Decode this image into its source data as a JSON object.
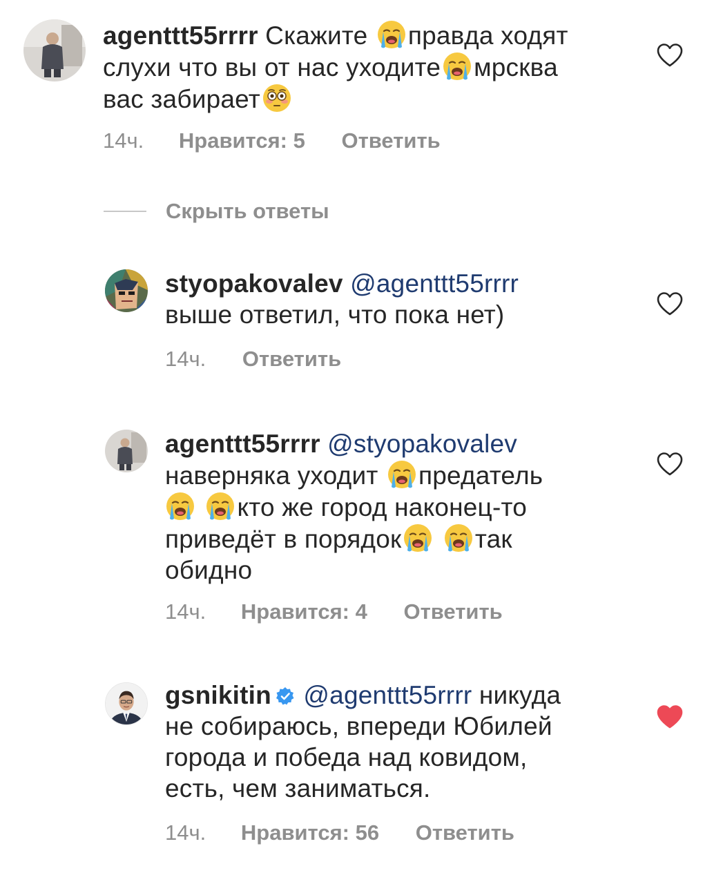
{
  "comments": [
    {
      "username": "agenttt55rrrr",
      "lines": [
        [
          "Скажите ",
          "{crying}",
          "правда ходят"
        ],
        [
          "слухи что вы от нас уходите",
          "{crying}",
          "мрсква"
        ],
        [
          "вас забирает",
          "{flushed}"
        ]
      ],
      "time": "14ч.",
      "likes": "Нравится: 5",
      "reply": "Ответить",
      "liked": false
    },
    {
      "username": "styopakovalev",
      "mention": "@agenttt55rrrr",
      "lines_text": [
        "выше ответил, что пока нет)"
      ],
      "time": "14ч.",
      "reply": "Ответить",
      "liked": false
    },
    {
      "username": "agenttt55rrrr",
      "mention": "@styopakovalev",
      "line2": "наверняка уходит ",
      "line2b": "предатель",
      "line3": "кто же город наконец-то",
      "line4": "приведёт в порядок",
      "line4b": "так",
      "line5": "обидно",
      "time": "14ч.",
      "likes": "Нравится: 4",
      "reply": "Ответить",
      "liked": false
    },
    {
      "username": "gsnikitin",
      "mention": "@agenttt55rrrr",
      "line1_tail": " никуда",
      "line2": "не собираюсь, впереди Юбилей",
      "line3": "города и победа над ковидом,",
      "line4": "есть, чем заниматься.",
      "time": "14ч.",
      "likes": "Нравится: 56",
      "reply": "Ответить",
      "liked": true
    }
  ],
  "hide_replies_label": "Скрыть ответы",
  "icons": {
    "heart": "heart-icon",
    "heart_filled": "heart-filled-icon",
    "verified": "verified-badge-icon",
    "crying": "loudly-crying-face-emoji",
    "flushed": "flushed-face-emoji"
  },
  "colors": {
    "text": "#262626",
    "meta": "#8e8e8e",
    "mention": "#1f3b70",
    "liked_heart": "#ed4956",
    "verified": "#3897f0"
  }
}
